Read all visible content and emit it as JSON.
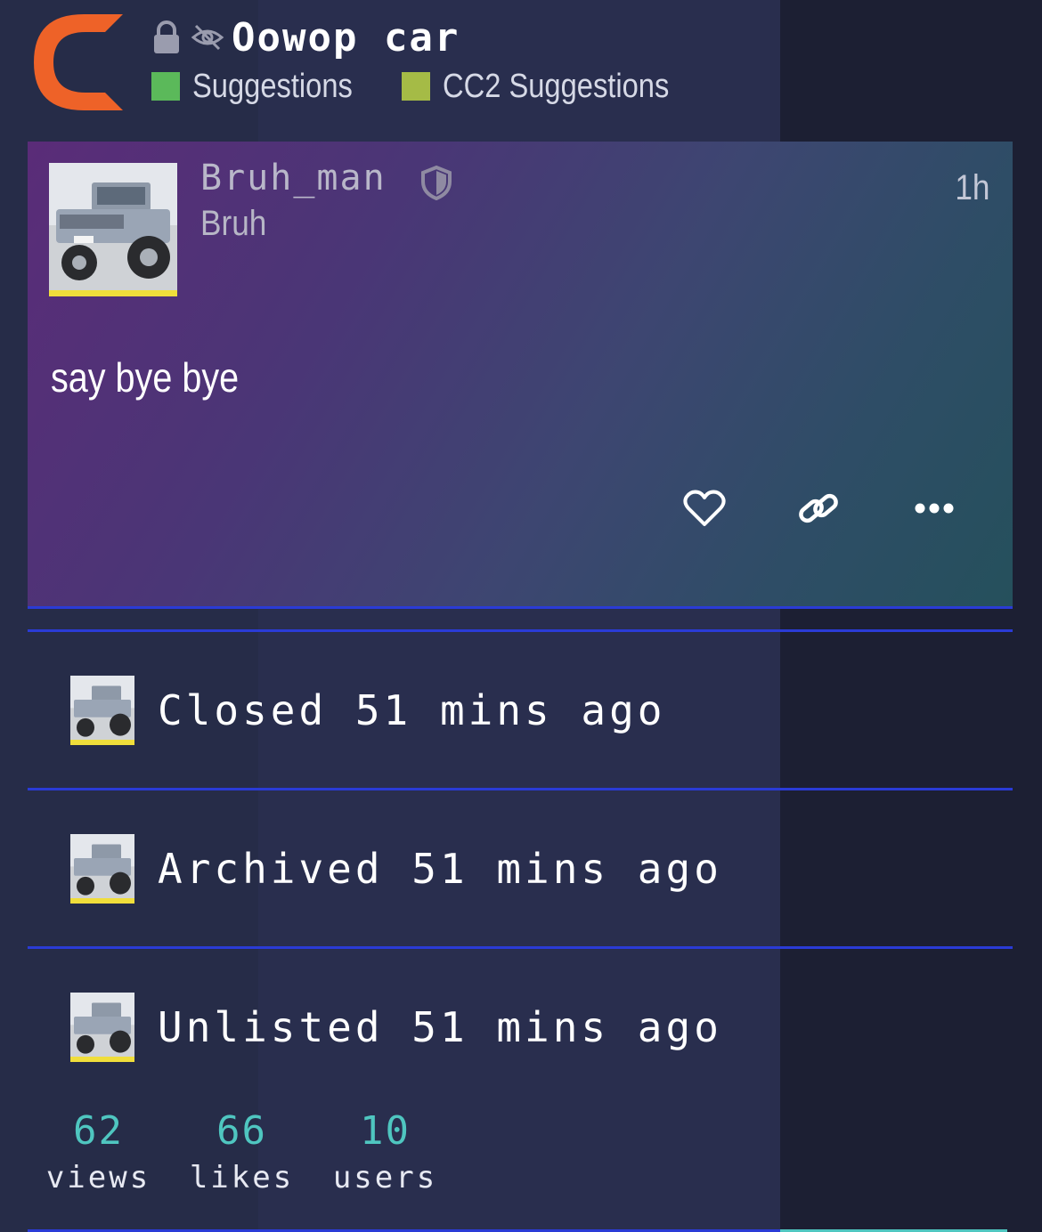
{
  "topic": {
    "title": "Oowop car",
    "categories": [
      {
        "label": "Suggestions",
        "color": "#5bb95a"
      },
      {
        "label": "CC2 Suggestions",
        "color": "#a5bb46"
      }
    ]
  },
  "post": {
    "username": "Bruh_man",
    "user_title": "Bruh",
    "time": "1h",
    "body": "say bye bye",
    "actions": [
      "like-icon",
      "link-icon",
      "more-icon"
    ]
  },
  "small_actions": [
    {
      "text": "Closed 51 mins ago"
    },
    {
      "text": "Archived 51 mins ago"
    },
    {
      "text": "Unlisted 51 mins ago"
    }
  ],
  "stats": [
    {
      "number": "62",
      "label": "views"
    },
    {
      "number": "66",
      "label": "likes"
    },
    {
      "number": "10",
      "label": "users"
    }
  ],
  "colors": {
    "accent_line": "#2a3bd6",
    "stat_number": "#4fc6c0",
    "logo": "#ee6228",
    "avatar_bar": "#f0de3b"
  }
}
